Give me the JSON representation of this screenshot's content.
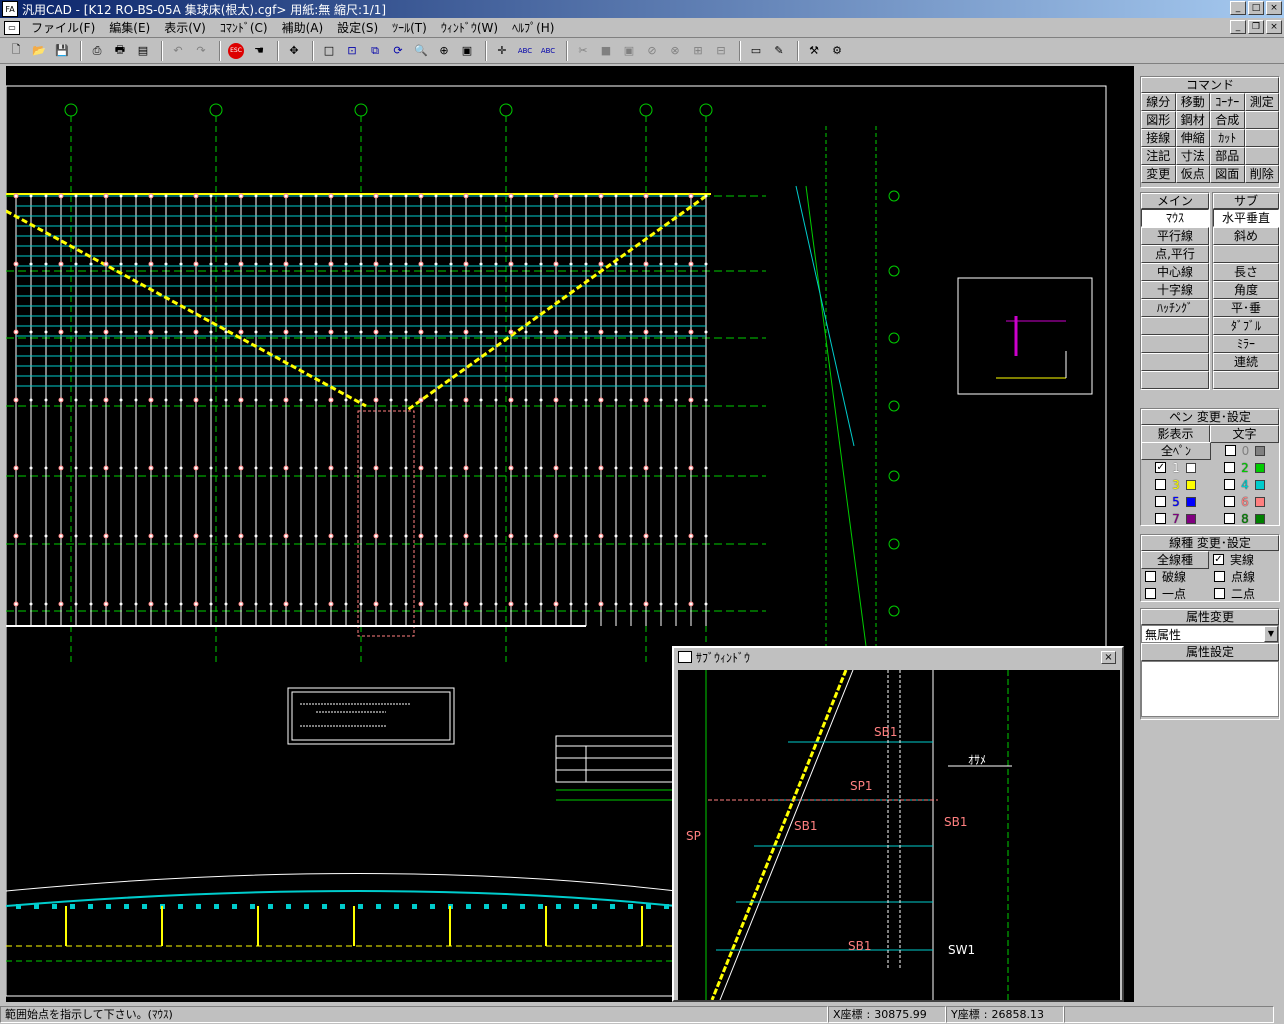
{
  "window": {
    "title": "汎用CAD - [K12 RO-BS-05A 集球床(根太).cgf> 用紙:無 縮尺:1/1]",
    "app_icon": "FA"
  },
  "menu": [
    "ファイル(F)",
    "編集(E)",
    "表示(V)",
    "ｺﾏﾝﾄﾞ(C)",
    "補助(A)",
    "設定(S)",
    "ﾂｰﾙ(T)",
    "ｳｨﾝﾄﾞｳ(W)",
    "ﾍﾙﾌﾟ(H)"
  ],
  "command_panel": {
    "header": "コマンド",
    "buttons": [
      "線分",
      "移動",
      "ｺｰﾅｰ",
      "測定",
      "図形",
      "鋼材",
      "合成",
      "",
      "接線",
      "伸縮",
      "ｶｯﾄ",
      "",
      "注記",
      "寸法",
      "部品",
      "",
      "変更",
      "仮点",
      "図面",
      "削除"
    ]
  },
  "main_panel": {
    "header": "メイン",
    "items": [
      "ﾏｳｽ",
      "平行線",
      "点,平行",
      "中心線",
      "十字線",
      "ﾊｯﾁﾝｸﾞ"
    ]
  },
  "sub_panel": {
    "header": "サブ",
    "items": [
      "水平垂直",
      "斜め",
      "",
      "長さ",
      "角度",
      "平･垂",
      "ﾀﾞﾌﾞﾙ",
      "ﾐﾗｰ",
      "連続"
    ]
  },
  "pen_panel": {
    "header": "ペン 変更･設定",
    "col_left": "影表示",
    "col_right": "文字",
    "all_label": "全ﾍﾟﾝ",
    "pens": [
      {
        "num": "1",
        "color": "#ffffff",
        "checked": true
      },
      {
        "num": "2",
        "color": "#00cc00",
        "checked": false
      },
      {
        "num": "3",
        "color": "#ffff00",
        "checked": false
      },
      {
        "num": "4",
        "color": "#00cccc",
        "checked": false
      },
      {
        "num": "5",
        "color": "#0000ff",
        "checked": false
      },
      {
        "num": "6",
        "color": "#ff8080",
        "checked": false
      },
      {
        "num": "7",
        "color": "#800080",
        "checked": false
      },
      {
        "num": "8",
        "color": "#008000",
        "checked": false
      }
    ],
    "zero_label": "0"
  },
  "linetype_panel": {
    "header": "線種 変更･設定",
    "all_label": "全線種",
    "types": [
      "実線",
      "破線",
      "点線",
      "一点",
      "二点"
    ],
    "checked": "実線"
  },
  "attr_panel": {
    "header": "属性変更",
    "select_value": "無属性",
    "setting_label": "属性設定"
  },
  "subwindow": {
    "title": "ｻﾌﾞｳｨﾝﾄﾞｳ",
    "labels": [
      "SB1",
      "SP1",
      "SB1",
      "SB1",
      "SP",
      "SB1",
      "ｵｻﾒ",
      "SW1"
    ]
  },
  "status": {
    "message": "範囲始点を指示して下さい。(ﾏｳｽ)",
    "x_label": "X座標",
    "x_value": "30875.99",
    "y_label": "Y座標",
    "y_value": "26858.13"
  }
}
